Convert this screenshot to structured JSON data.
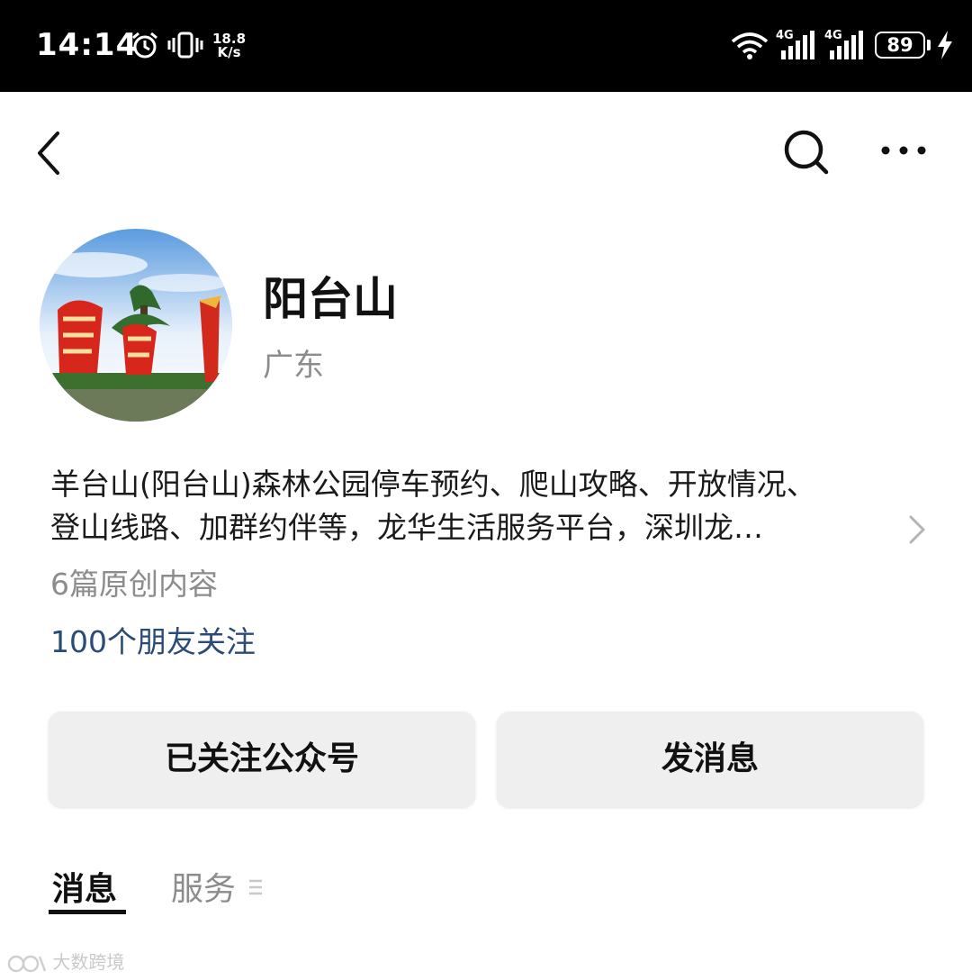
{
  "status_bar": {
    "time": "14:14",
    "speed_value": "18.8",
    "speed_unit": "K/s",
    "network_type_1": "4G",
    "network_type_2": "4G",
    "battery": "89",
    "icons": [
      "alarm-icon",
      "vibrate-icon",
      "wifi-icon",
      "signal-icon",
      "signal-icon",
      "battery-icon",
      "charging-icon"
    ]
  },
  "nav": {
    "icons": [
      "back-icon",
      "search-icon",
      "more-icon"
    ]
  },
  "profile": {
    "name": "阳台山",
    "region": "广东",
    "description_line1": "羊台山(阳台山)森林公园停车预约、爬山攻略、开放情况、",
    "description_line2": "登山线路、加群约伴等，龙华生活服务平台，深圳龙…",
    "articles": "6篇原创内容",
    "followers": "100个朋友关注"
  },
  "actions": {
    "follow_label": "已关注公众号",
    "message_label": "发消息"
  },
  "tabs": [
    {
      "label": "消息",
      "active": true
    },
    {
      "label": "服务",
      "active": false
    }
  ],
  "watermark": "大数跨境",
  "colors": {
    "status_bar_bg": "#000000",
    "follower_link": "#2a4a78",
    "secondary_text": "#8c8c8c",
    "button_bg": "#efefef"
  }
}
